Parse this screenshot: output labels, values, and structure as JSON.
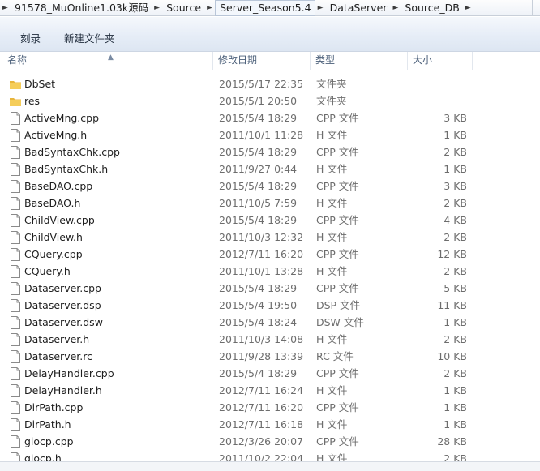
{
  "breadcrumb": {
    "items": [
      "91578_MuOnline1.03k源码",
      "Source",
      "Server_Season5.4",
      "DataServer",
      "Source_DB"
    ]
  },
  "toolbar": {
    "burn_label": "刻录",
    "new_folder_label": "新建文件夹"
  },
  "columns": {
    "name": "名称",
    "date": "修改日期",
    "type": "类型",
    "size": "大小"
  },
  "files": [
    {
      "name": "DbSet",
      "date": "2015/5/17 22:35",
      "type": "文件夹",
      "size": "",
      "kind": "folder"
    },
    {
      "name": "res",
      "date": "2015/5/1 20:50",
      "type": "文件夹",
      "size": "",
      "kind": "folder"
    },
    {
      "name": "ActiveMng.cpp",
      "date": "2015/5/4 18:29",
      "type": "CPP 文件",
      "size": "3 KB",
      "kind": "file"
    },
    {
      "name": "ActiveMng.h",
      "date": "2011/10/1 11:28",
      "type": "H 文件",
      "size": "1 KB",
      "kind": "file"
    },
    {
      "name": "BadSyntaxChk.cpp",
      "date": "2015/5/4 18:29",
      "type": "CPP 文件",
      "size": "2 KB",
      "kind": "file"
    },
    {
      "name": "BadSyntaxChk.h",
      "date": "2011/9/27 0:44",
      "type": "H 文件",
      "size": "1 KB",
      "kind": "file"
    },
    {
      "name": "BaseDAO.cpp",
      "date": "2015/5/4 18:29",
      "type": "CPP 文件",
      "size": "3 KB",
      "kind": "file"
    },
    {
      "name": "BaseDAO.h",
      "date": "2011/10/5 7:59",
      "type": "H 文件",
      "size": "2 KB",
      "kind": "file"
    },
    {
      "name": "ChildView.cpp",
      "date": "2015/5/4 18:29",
      "type": "CPP 文件",
      "size": "4 KB",
      "kind": "file"
    },
    {
      "name": "ChildView.h",
      "date": "2011/10/3 12:32",
      "type": "H 文件",
      "size": "2 KB",
      "kind": "file"
    },
    {
      "name": "CQuery.cpp",
      "date": "2012/7/11 16:20",
      "type": "CPP 文件",
      "size": "12 KB",
      "kind": "file"
    },
    {
      "name": "CQuery.h",
      "date": "2011/10/1 13:28",
      "type": "H 文件",
      "size": "2 KB",
      "kind": "file"
    },
    {
      "name": "Dataserver.cpp",
      "date": "2015/5/4 18:29",
      "type": "CPP 文件",
      "size": "5 KB",
      "kind": "file"
    },
    {
      "name": "Dataserver.dsp",
      "date": "2015/5/4 19:50",
      "type": "DSP 文件",
      "size": "11 KB",
      "kind": "file"
    },
    {
      "name": "Dataserver.dsw",
      "date": "2015/5/4 18:24",
      "type": "DSW 文件",
      "size": "1 KB",
      "kind": "file"
    },
    {
      "name": "Dataserver.h",
      "date": "2011/10/3 14:08",
      "type": "H 文件",
      "size": "2 KB",
      "kind": "file"
    },
    {
      "name": "Dataserver.rc",
      "date": "2011/9/28 13:39",
      "type": "RC 文件",
      "size": "10 KB",
      "kind": "file"
    },
    {
      "name": "DelayHandler.cpp",
      "date": "2015/5/4 18:29",
      "type": "CPP 文件",
      "size": "2 KB",
      "kind": "file"
    },
    {
      "name": "DelayHandler.h",
      "date": "2012/7/11 16:24",
      "type": "H 文件",
      "size": "1 KB",
      "kind": "file"
    },
    {
      "name": "DirPath.cpp",
      "date": "2012/7/11 16:20",
      "type": "CPP 文件",
      "size": "1 KB",
      "kind": "file"
    },
    {
      "name": "DirPath.h",
      "date": "2012/7/11 16:18",
      "type": "H 文件",
      "size": "1 KB",
      "kind": "file"
    },
    {
      "name": "giocp.cpp",
      "date": "2012/3/26 20:07",
      "type": "CPP 文件",
      "size": "28 KB",
      "kind": "file"
    },
    {
      "name": "giocp.h",
      "date": "2011/10/2 22:04",
      "type": "H 文件",
      "size": "2 KB",
      "kind": "file"
    }
  ]
}
